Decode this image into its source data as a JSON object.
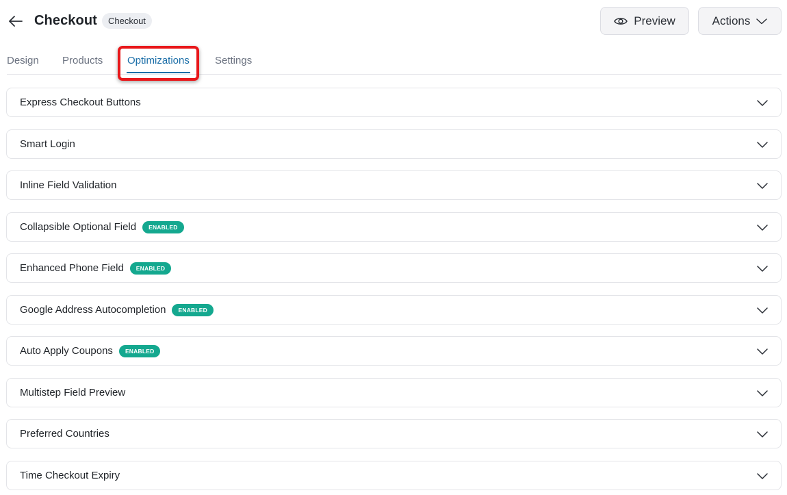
{
  "header": {
    "title": "Checkout",
    "badge": "Checkout",
    "back_icon": "arrow-left-icon",
    "preview_label": "Preview",
    "preview_icon": "eye-icon",
    "actions_label": "Actions",
    "actions_icon": "chevron-down-icon"
  },
  "tabs": [
    {
      "label": "Design",
      "active": false
    },
    {
      "label": "Products",
      "active": false
    },
    {
      "label": "Optimizations",
      "active": true
    },
    {
      "label": "Settings",
      "active": false
    }
  ],
  "colors": {
    "accent": "#1b6ea8",
    "badge_enabled": "#14a88f",
    "highlight_box": "#e8171a"
  },
  "sections": [
    {
      "title": "Express Checkout Buttons",
      "badge": null
    },
    {
      "title": "Smart Login",
      "badge": null
    },
    {
      "title": "Inline Field Validation",
      "badge": null
    },
    {
      "title": "Collapsible Optional Field",
      "badge": "ENABLED"
    },
    {
      "title": "Enhanced Phone Field",
      "badge": "ENABLED"
    },
    {
      "title": "Google Address Autocompletion",
      "badge": "ENABLED"
    },
    {
      "title": "Auto Apply Coupons",
      "badge": "ENABLED"
    },
    {
      "title": "Multistep Field Preview",
      "badge": null
    },
    {
      "title": "Preferred Countries",
      "badge": null
    },
    {
      "title": "Time Checkout Expiry",
      "badge": null
    }
  ]
}
